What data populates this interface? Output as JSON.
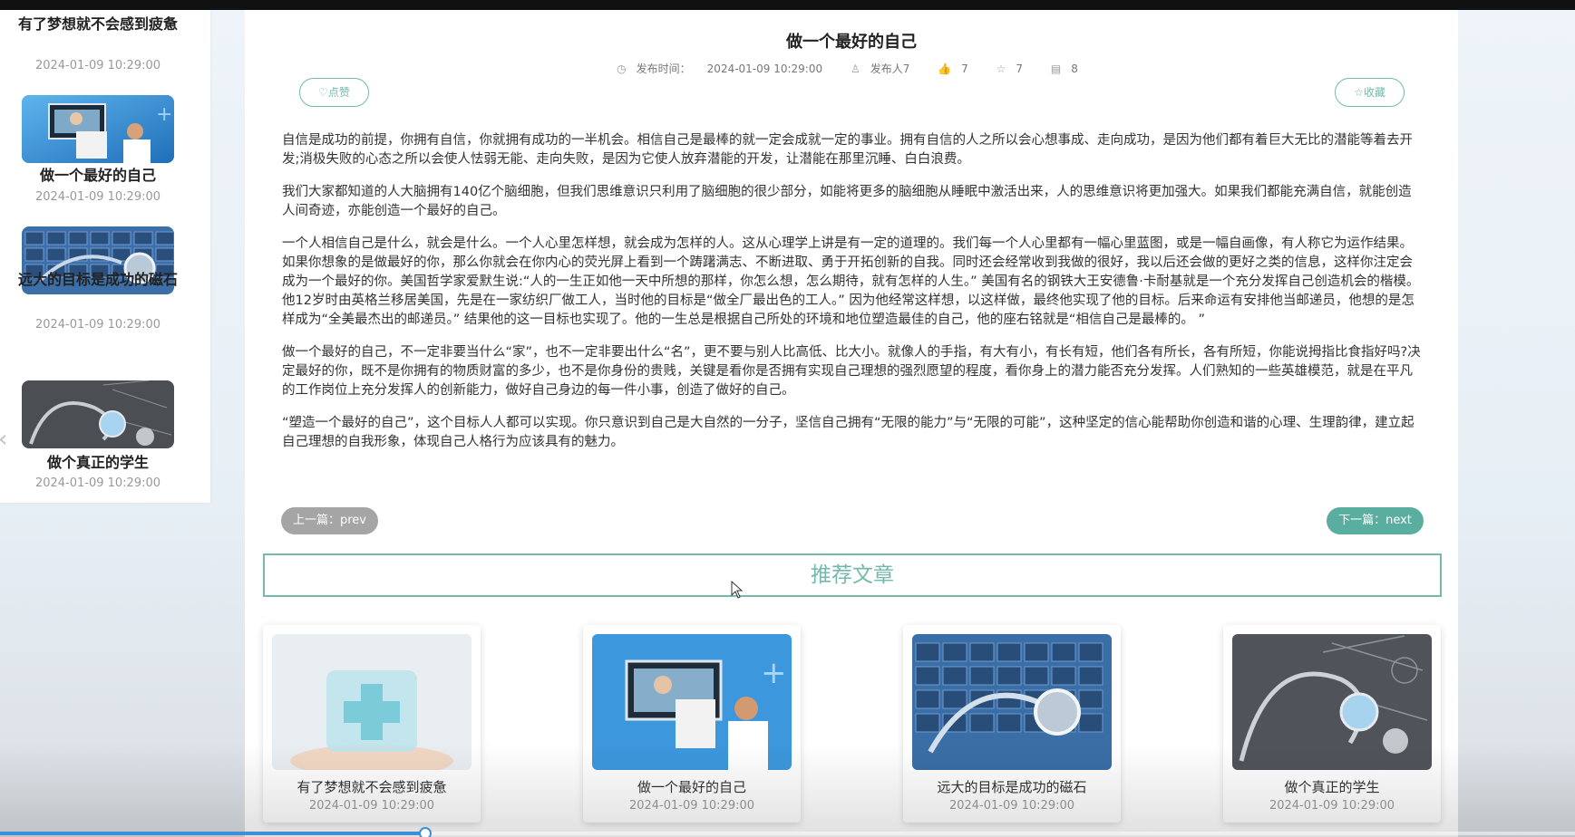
{
  "sidebar": {
    "items": [
      {
        "title": "有了梦想就不会感到疲惫",
        "date": "2024-01-09 10:29:00"
      },
      {
        "title": "做一个最好的自己",
        "date": "2024-01-09 10:29:00"
      },
      {
        "title": "远大的目标是成功的磁石",
        "date": "2024-01-09 10:29:00"
      },
      {
        "title": "做个真正的学生",
        "date": "2024-01-09 10:29:00"
      }
    ],
    "prev_arrow": "‹"
  },
  "article": {
    "title": "做一个最好的自己",
    "published_label": "发布时间：",
    "published": "2024-01-09 10:29:00",
    "author": "发布人7",
    "likes": "7",
    "favorites": "7",
    "comments": "8",
    "like_label": "点赞",
    "fav_label": "收藏",
    "paragraphs": [
      "自信是成功的前提，你拥有自信，你就拥有成功的一半机会。相信自己是最棒的就一定会成就一定的事业。拥有自信的人之所以会心想事成、走向成功，是因为他们都有着巨大无比的潜能等着去开发;消极失败的心态之所以会使人怯弱无能、走向失败，是因为它使人放弃潜能的开发，让潜能在那里沉睡、白白浪费。",
      "我们大家都知道的人大脑拥有140亿个脑细胞，但我们思维意识只利用了脑细胞的很少部分，如能将更多的脑细胞从睡眠中激活出来，人的思维意识将更加强大。如果我们都能充满自信，就能创造人间奇迹，亦能创造一个最好的自己。",
      "一个人相信自己是什么，就会是什么。一个人心里怎样想，就会成为怎样的人。这从心理学上讲是有一定的道理的。我们每一个人心里都有一幅心里蓝图，或是一幅自画像，有人称它为运作结果。如果你想象的是做最好的你，那么你就会在你内心的荧光屏上看到一个踌躇满志、不断进取、勇于开拓创新的自我。同时还会经常收到我做的很好，我以后还会做的更好之类的信息，这样你注定会成为一个最好的你。美国哲学家爱默生说:“人的一生正如他一天中所想的那样，你怎么想，怎么期待，就有怎样的人生。” 美国有名的钢铁大王安德鲁·卡耐基就是一个充分发挥自己创造机会的楷模。他12岁时由英格兰移居美国，先是在一家纺织厂做工人，当时他的目标是“做全厂最出色的工人。” 因为他经常这样想，以这样做，最终他实现了他的目标。后来命运有安排他当邮递员，他想的是怎样成为“全美最杰出的邮递员。” 结果他的这一目标也实现了。他的一生总是根据自己所处的环境和地位塑造最佳的自己，他的座右铭就是“相信自己是最棒的。 ”",
      "做一个最好的自己，不一定非要当什么“家”，也不一定非要出什么“名”，更不要与别人比高低、比大小。就像人的手指，有大有小，有长有短，他们各有所长，各有所短，你能说拇指比食指好吗?决定最好的你，既不是你拥有的物质财富的多少，也不是你身份的贵贱，关键是看你是否拥有实现自己理想的强烈愿望的程度，看你身上的潜力能否充分发挥。人们熟知的一些英雄模范，就是在平凡的工作岗位上充分发挥人的创新能力，做好自己身边的每一件小事，创造了做好的自己。",
      "“塑造一个最好的自己”，这个目标人人都可以实现。你只意识到自己是大自然的一分子，坚信自己拥有“无限的能力”与“无限的可能”，这种坚定的信心能帮助你创造和谐的心理、生理韵律，建立起自己理想的自我形象，体现自己人格行为应该具有的魅力。"
    ],
    "prev_label": "上一篇：prev",
    "next_label": "下一篇：next"
  },
  "recommend": {
    "header": "推荐文章",
    "items": [
      {
        "title": "有了梦想就不会感到疲惫",
        "date": "2024-01-09 10:29:00"
      },
      {
        "title": "做一个最好的自己",
        "date": "2024-01-09 10:29:00"
      },
      {
        "title": "远大的目标是成功的磁石",
        "date": "2024-01-09 10:29:00"
      },
      {
        "title": "做个真正的学生",
        "date": "2024-01-09 10:29:00"
      }
    ]
  },
  "player": {
    "progress": 0.27
  },
  "colors": {
    "accent": "#74b9ac",
    "next_bg": "#5aaea0",
    "prev_bg": "#a5a5a5"
  }
}
